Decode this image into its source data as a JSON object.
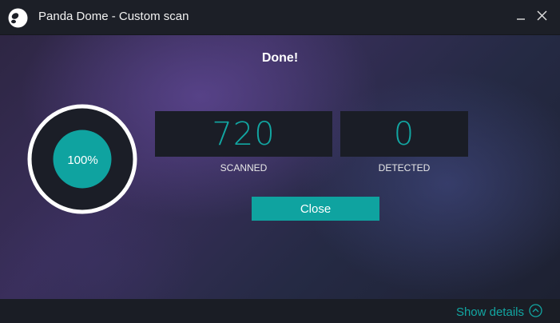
{
  "window": {
    "title": "Panda Dome - Custom scan"
  },
  "scan": {
    "status": "Done!",
    "progress_label": "100%",
    "progress_fraction": 1.0,
    "scanned_value": "720",
    "scanned_label": "SCANNED",
    "detected_value": "0",
    "detected_label": "DETECTED"
  },
  "actions": {
    "close_label": "Close",
    "details_label": "Show details"
  },
  "icons": {
    "app": "panda-logo-icon",
    "minimize": "minimize-icon",
    "close": "close-icon",
    "details": "chevron-up-circle-icon"
  },
  "colors": {
    "accent": "#0fa3a0",
    "titlebar": "#1c1f27",
    "panel": "#1a1d26"
  }
}
